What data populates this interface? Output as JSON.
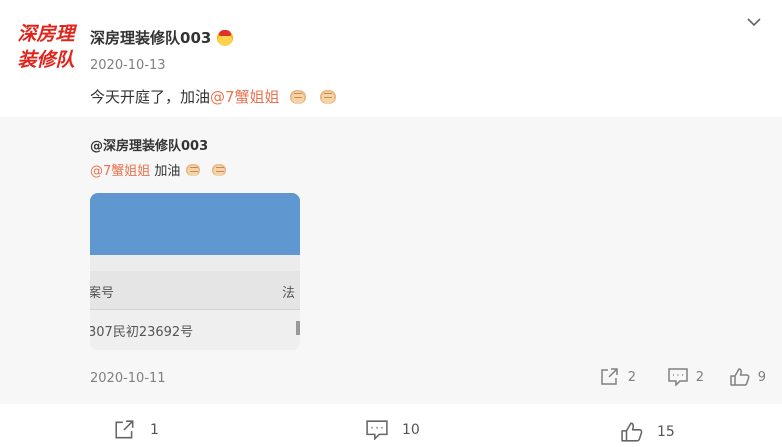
{
  "post": {
    "avatar_lines": [
      "深房理",
      "装修队"
    ],
    "username": "深房理装修队003",
    "date": "2020-10-13",
    "text_prefix": "今天开庭了，加油",
    "mention": "@7蟹姐姐"
  },
  "repost": {
    "author": "@深房理装修队003",
    "mention": "@7蟹姐姐",
    "text": " 加油",
    "image": {
      "header_left": "案号",
      "header_right": "法",
      "value_left": "307民初23692号"
    },
    "date": "2020-10-11",
    "actions": {
      "share_count": "2",
      "comment_count": "2",
      "like_count": "9"
    }
  },
  "actions": {
    "share_count": "1",
    "comment_count": "10",
    "like_count": "15"
  },
  "colors": {
    "accent": "#eb7350",
    "logo_red": "#e0251d",
    "repost_bg": "#f7f7f7",
    "image_band": "#5f97d1"
  },
  "icons": [
    "vip-crown-icon",
    "chevron-down-icon",
    "fist-emoji-icon",
    "share-icon",
    "comment-icon",
    "like-icon"
  ]
}
